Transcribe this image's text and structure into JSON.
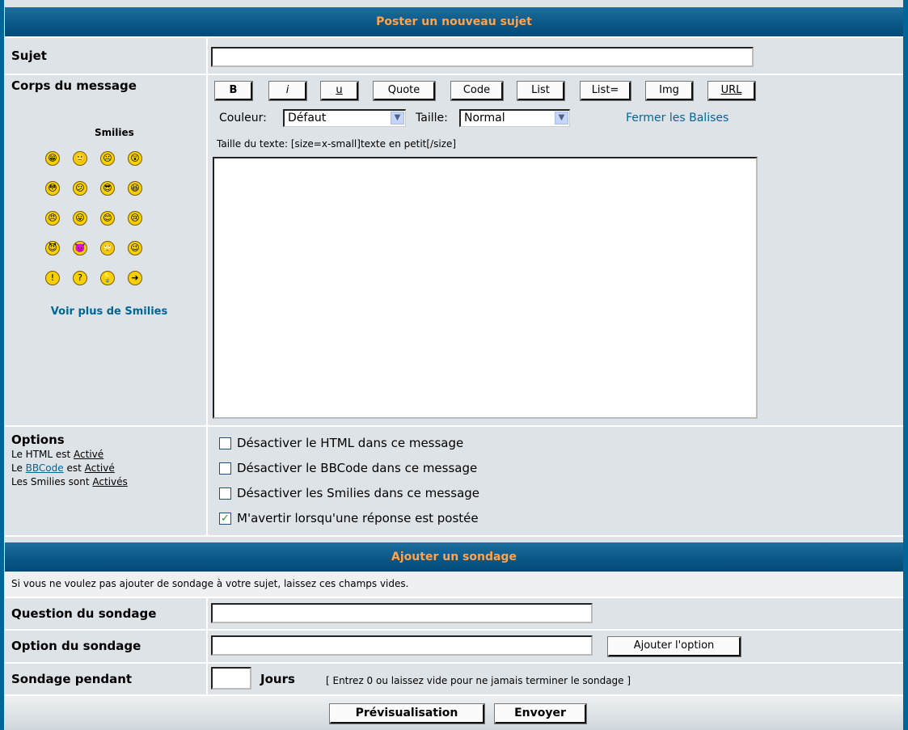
{
  "post_section": {
    "title": "Poster un nouveau sujet",
    "subject_label": "Sujet",
    "subject_value": "",
    "body_label": "Corps du message",
    "smilies_title": "Smilies",
    "more_smilies": "Voir plus de Smilies",
    "smilies": [
      {
        "name": "very-happy-smiley-icon",
        "glyph": "😁"
      },
      {
        "name": "smile-smiley-icon",
        "glyph": "🙂"
      },
      {
        "name": "sad-smiley-icon",
        "glyph": "☹"
      },
      {
        "name": "surprised-smiley-icon",
        "glyph": "😲"
      },
      {
        "name": "shocked-smiley-icon",
        "glyph": "😳"
      },
      {
        "name": "confused-smiley-icon",
        "glyph": "😕"
      },
      {
        "name": "cool-smiley-icon",
        "glyph": "😎"
      },
      {
        "name": "laughing-smiley-icon",
        "glyph": "😆"
      },
      {
        "name": "mad-smiley-icon",
        "glyph": "😠"
      },
      {
        "name": "razz-smiley-icon",
        "glyph": "😛"
      },
      {
        "name": "embarrassed-smiley-icon",
        "glyph": "😊"
      },
      {
        "name": "crying-smiley-icon",
        "glyph": "😢"
      },
      {
        "name": "evil-smiley-icon",
        "glyph": "😈"
      },
      {
        "name": "twisted-evil-smiley-icon",
        "glyph": "👿"
      },
      {
        "name": "rolling-eyes-smiley-icon",
        "glyph": "🙄"
      },
      {
        "name": "wink-smiley-icon",
        "glyph": "😉"
      },
      {
        "name": "exclamation-smiley-icon",
        "glyph": "!"
      },
      {
        "name": "question-smiley-icon",
        "glyph": "?"
      },
      {
        "name": "idea-smiley-icon",
        "glyph": "💡"
      },
      {
        "name": "arrow-smiley-icon",
        "glyph": "➜"
      }
    ]
  },
  "toolbar": {
    "buttons": [
      "B",
      "i",
      "u",
      "Quote",
      "Code",
      "List",
      "List=",
      "Img",
      "URL"
    ],
    "color_label": "Couleur:",
    "color_value": "Défaut",
    "size_label": "Taille:",
    "size_value": "Normal",
    "close_tags": "Fermer les Balises",
    "help_text": "Taille du texte: [size=x-small]texte en petit[/size]"
  },
  "message_body": "",
  "options": {
    "title": "Options",
    "html_prefix": "Le HTML est ",
    "html_state": "Activé",
    "bbcode_prefix": "Le ",
    "bbcode_link": "BBCode",
    "bbcode_mid": " est ",
    "bbcode_state": "Activé",
    "smilies_prefix": "Les Smilies sont ",
    "smilies_state": "Activés",
    "checkboxes": [
      {
        "label": "Désactiver le HTML dans ce message",
        "checked": false
      },
      {
        "label": "Désactiver le BBCode dans ce message",
        "checked": false
      },
      {
        "label": "Désactiver les Smilies dans ce message",
        "checked": false
      },
      {
        "label": "M'avertir lorsqu'une réponse est postée",
        "checked": true
      }
    ]
  },
  "poll": {
    "title": "Ajouter un sondage",
    "note": "Si vous ne voulez pas ajouter de sondage à votre sujet, laissez ces champs vides.",
    "question_label": "Question du sondage",
    "question_value": "",
    "option_label": "Option du sondage",
    "option_value": "",
    "add_option": "Ajouter l'option",
    "duration_label": "Sondage pendant",
    "duration_value": "",
    "days": "Jours",
    "duration_hint": "[ Entrez 0 ou laissez vide pour ne jamais terminer le sondage ]"
  },
  "actions": {
    "preview": "Prévisualisation",
    "submit": "Envoyer"
  },
  "colors": {
    "header_bg": "#0b5a8a",
    "header_text": "#ffa34f",
    "row_bg": "#dee3e7",
    "link": "#006699"
  }
}
